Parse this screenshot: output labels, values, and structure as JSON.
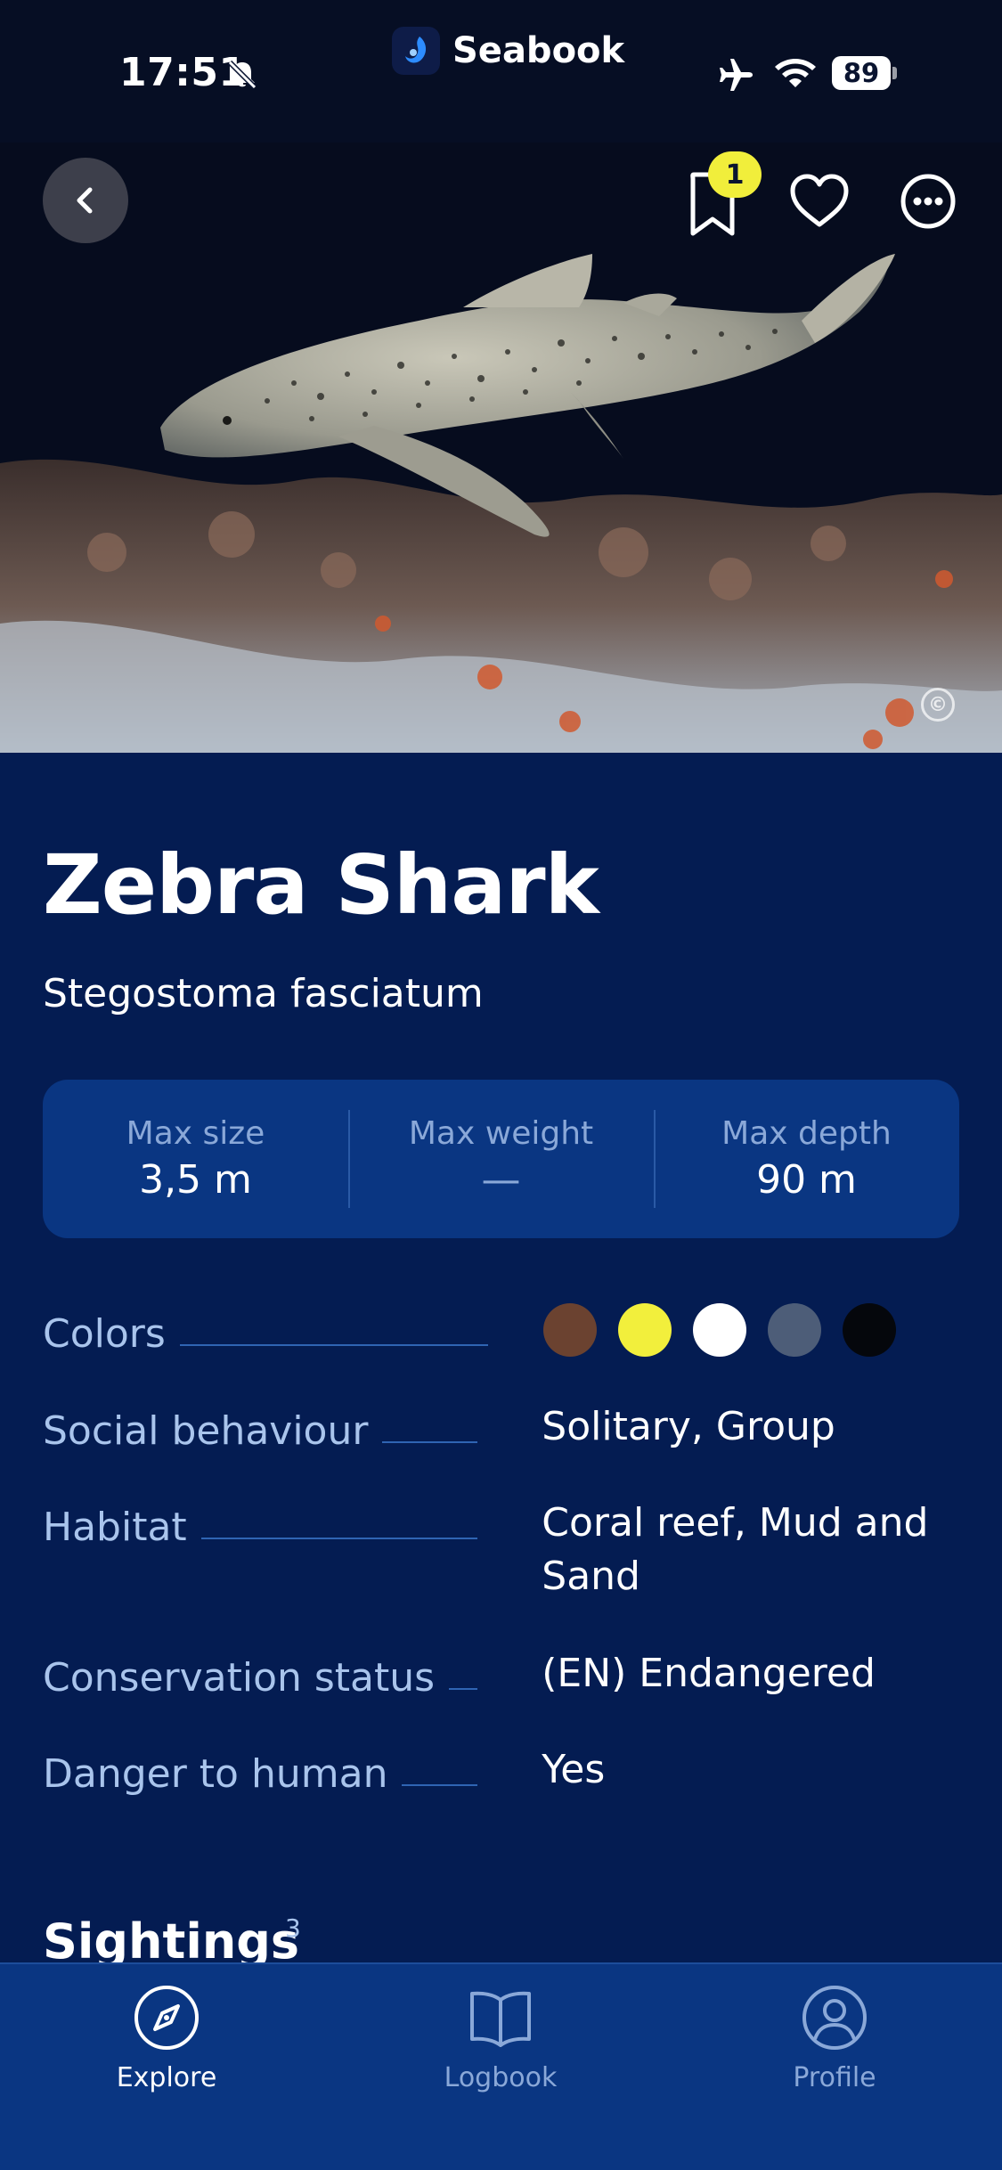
{
  "status_bar": {
    "time": "17:51",
    "battery": "89"
  },
  "app": {
    "name": "Seabook"
  },
  "header": {
    "bookmark_count": "1",
    "copyright_symbol": "©"
  },
  "species": {
    "common_name": "Zebra Shark",
    "latin_name": "Stegostoma fasciatum"
  },
  "stats": [
    {
      "label": "Max size",
      "value": "3,5 m"
    },
    {
      "label": "Max weight",
      "value": "—"
    },
    {
      "label": "Max depth",
      "value": "90 m"
    }
  ],
  "attributes": {
    "colors": {
      "label": "Colors",
      "swatches": [
        "#6b4230",
        "#f2ef3c",
        "#ffffff",
        "#4d5d78",
        "#05070c"
      ]
    },
    "social": {
      "label": "Social behaviour",
      "value": "Solitary, Group"
    },
    "habitat": {
      "label": "Habitat",
      "value": "Coral reef, Mud and Sand"
    },
    "conservation": {
      "label": "Conservation status",
      "value": "(EN) Endangered"
    },
    "danger": {
      "label": "Danger to human",
      "value": "Yes"
    }
  },
  "sightings": {
    "heading": "Sightings",
    "count": "3"
  },
  "tabs": [
    {
      "label": "Explore",
      "icon": "compass-icon",
      "active": true
    },
    {
      "label": "Logbook",
      "icon": "book-icon",
      "active": false
    },
    {
      "label": "Profile",
      "icon": "user-icon",
      "active": false
    }
  ],
  "colors": {
    "background": "#041c52",
    "card": "#0a3682",
    "accent_yellow": "#f1ee3b",
    "label": "#a9c4ec"
  }
}
